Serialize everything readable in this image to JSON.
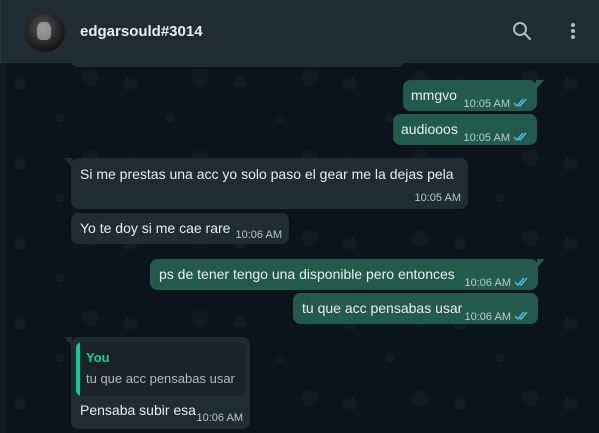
{
  "header": {
    "contact_name": "edgarsould#3014",
    "avatar_icon": "contact-avatar",
    "search_icon": "search-icon",
    "menu_icon": "kebab-menu-icon"
  },
  "colors": {
    "header_bg": "#202c33",
    "chat_bg": "#0b141a",
    "outgoing_bubble": "#225b4c",
    "incoming_bubble": "#202c33",
    "read_ticks": "#53bdeb",
    "reply_accent": "#06cf9c"
  },
  "messages": [
    {
      "direction": "outgoing",
      "text": "mmgvo",
      "time": "10:05 AM",
      "status": "read"
    },
    {
      "direction": "outgoing",
      "text": "audiooos",
      "time": "10:05 AM",
      "status": "read"
    },
    {
      "direction": "incoming",
      "text": "Si me prestas una acc yo solo paso el gear me la dejas pela",
      "time": "10:05 AM"
    },
    {
      "direction": "incoming",
      "text": "Yo te doy si me cae rare",
      "time": "10:06 AM"
    },
    {
      "direction": "outgoing",
      "text": "ps de tener tengo una disponible pero entonces",
      "time": "10:06 AM",
      "status": "read"
    },
    {
      "direction": "outgoing",
      "text": "tu que acc pensabas usar",
      "time": "10:06 AM",
      "status": "read"
    },
    {
      "direction": "incoming",
      "reply_to": {
        "author": "You",
        "text": "tu que acc pensabas usar"
      },
      "text": "Pensaba subir esa",
      "time": "10:06 AM"
    }
  ]
}
